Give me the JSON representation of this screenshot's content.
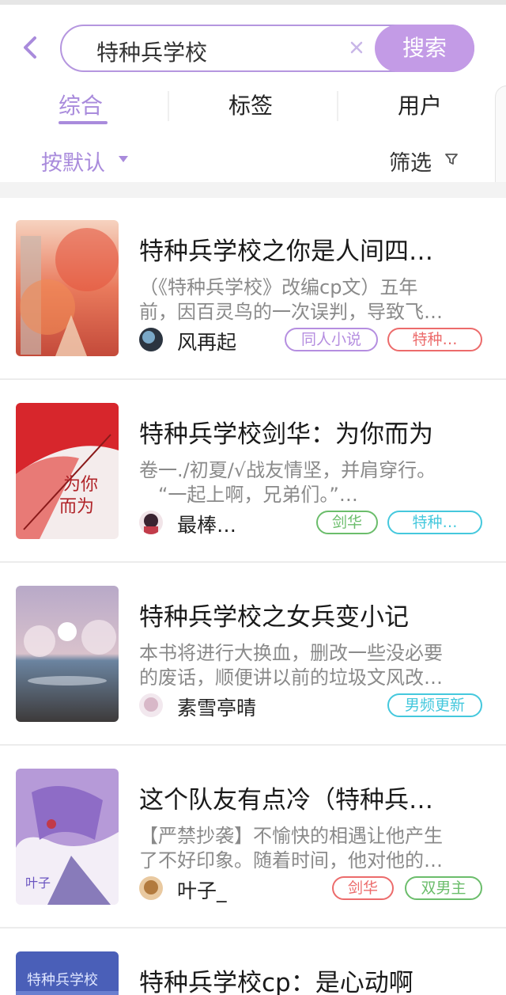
{
  "header": {
    "search_value": "特种兵学校",
    "search_button": "搜索"
  },
  "tabs": [
    {
      "label": "综合",
      "active": true
    },
    {
      "label": "标签",
      "active": false
    },
    {
      "label": "用户",
      "active": false
    }
  ],
  "filters": {
    "sort_label": "按默认",
    "filter_label": "筛选"
  },
  "colors": {
    "accent": "#a98bdc",
    "tag_purple": "#b58ee0",
    "tag_red": "#ec6b6b",
    "tag_green": "#6bbd6b",
    "tag_cyan": "#45c8dd"
  },
  "books": [
    {
      "title": "特种兵学校之你是人间四…",
      "desc_lines": [
        "（《特种兵学校》改编cp文）五年",
        "前，因百灵鸟的一次误判，导致飞…"
      ],
      "author": "风再起",
      "tags": [
        {
          "label": "同人小说",
          "color": "purple"
        },
        {
          "label": "特种…",
          "color": "red"
        }
      ]
    },
    {
      "title": "特种兵学校剑华：为你而为",
      "desc_lines": [
        "卷一./初夏/√战友情坚，并肩穿行。",
        "“一起上啊，兄弟们。”…"
      ],
      "author": "最棒…",
      "tags": [
        {
          "label": "剑华",
          "color": "green"
        },
        {
          "label": "特种…",
          "color": "cyan"
        }
      ]
    },
    {
      "title": "特种兵学校之女兵变小记",
      "desc_lines": [
        "本书将进行大换血，删改一些没必要",
        "的废话，顺便讲以前的垃圾文风改…"
      ],
      "author": "素雪亭晴",
      "tags": [
        {
          "label": "男频更新",
          "color": "cyan"
        }
      ]
    },
    {
      "title": "这个队友有点冷（特种兵…",
      "desc_lines": [
        "【严禁抄袭】不愉快的相遇让他产生",
        "了不好印象。随着时间，他对他的…"
      ],
      "author": "叶子_",
      "tags": [
        {
          "label": "剑华",
          "color": "red"
        },
        {
          "label": "双男主",
          "color": "green"
        }
      ]
    },
    {
      "title": "特种兵学校cp：是心动啊",
      "desc_lines": [],
      "author": "",
      "tags": []
    }
  ]
}
